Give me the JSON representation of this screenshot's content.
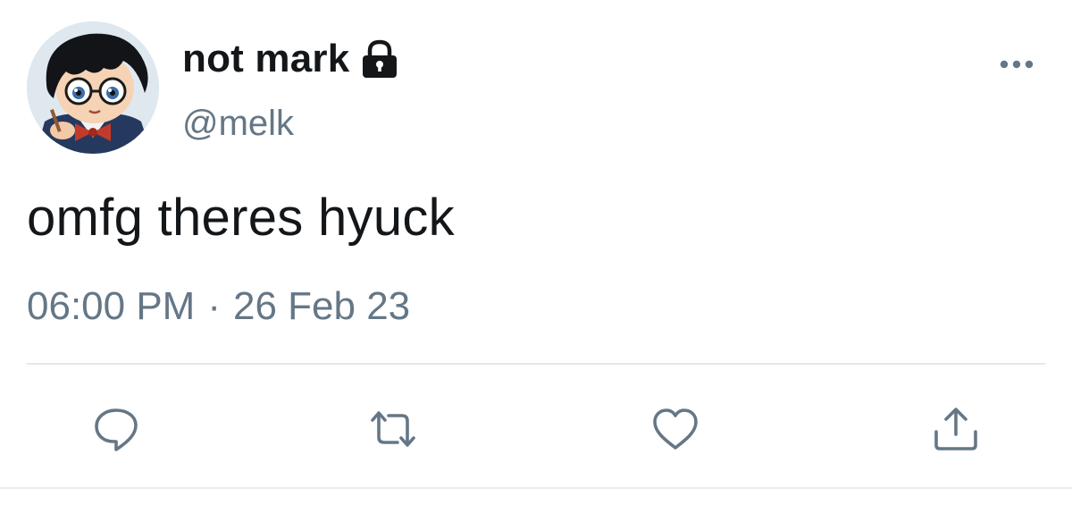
{
  "tweet": {
    "display_name": "not mark",
    "handle": "@melk",
    "text": "omfg theres hyuck",
    "time": "06:00 PM",
    "separator": "·",
    "date": "26 Feb 23",
    "protected": true
  },
  "icons": {
    "lock": "lock-icon",
    "more": "more-icon",
    "reply": "reply-icon",
    "retweet": "retweet-icon",
    "like": "heart-icon",
    "share": "share-icon"
  },
  "colors": {
    "text_primary": "#14171a",
    "text_secondary": "#657786",
    "divider": "#e1e8ed"
  }
}
